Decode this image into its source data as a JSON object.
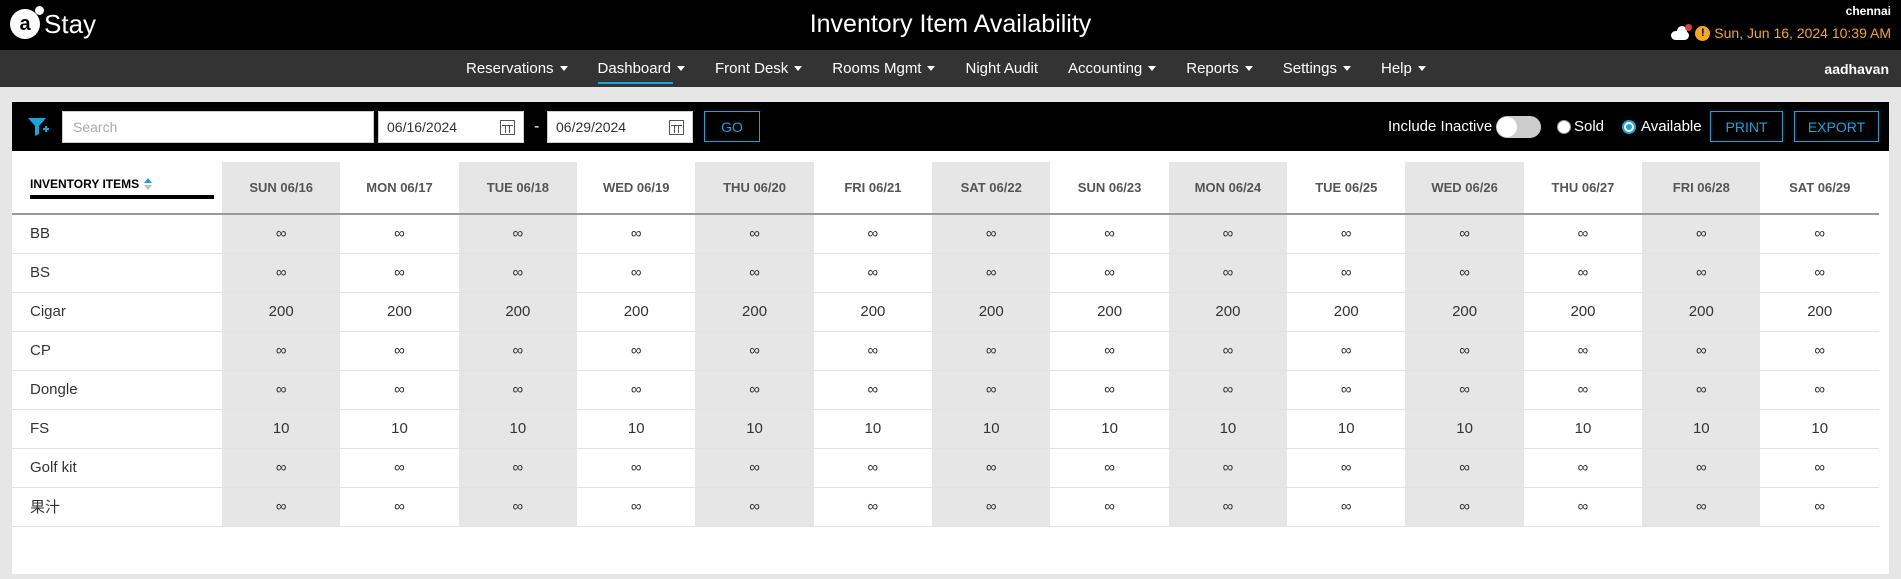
{
  "app": {
    "logo_letter": "a",
    "logo_text": "Stay",
    "title": "Inventory Item Availability",
    "location": "chennai",
    "datetime": "Sun, Jun 16, 2024 10:39 AM",
    "alert_glyph": "!"
  },
  "nav": {
    "items": [
      {
        "label": "Reservations",
        "dropdown": true
      },
      {
        "label": "Dashboard",
        "dropdown": true,
        "active": true
      },
      {
        "label": "Front Desk",
        "dropdown": true
      },
      {
        "label": "Rooms Mgmt",
        "dropdown": true
      },
      {
        "label": "Night Audit",
        "dropdown": false
      },
      {
        "label": "Accounting",
        "dropdown": true
      },
      {
        "label": "Reports",
        "dropdown": true
      },
      {
        "label": "Settings",
        "dropdown": true
      },
      {
        "label": "Help",
        "dropdown": true
      }
    ],
    "user": "aadhavan"
  },
  "toolbar": {
    "search_placeholder": "Search",
    "search_value": "",
    "start_date": "06/16/2024",
    "end_date": "06/29/2024",
    "date_separator": "-",
    "go_label": "GO",
    "include_inactive_label": "Include Inactive",
    "include_inactive_on": false,
    "sold_label": "Sold",
    "available_label": "Available",
    "selected_mode": "Available",
    "print_label": "PRINT",
    "export_label": "EXPORT",
    "accent_color": "#1aa3d9"
  },
  "table": {
    "item_header": "INVENTORY ITEMS",
    "columns": [
      "SUN 06/16",
      "MON 06/17",
      "TUE 06/18",
      "WED 06/19",
      "THU 06/20",
      "FRI 06/21",
      "SAT 06/22",
      "SUN 06/23",
      "MON 06/24",
      "TUE 06/25",
      "WED 06/26",
      "THU 06/27",
      "FRI 06/28",
      "SAT 06/29"
    ],
    "rows": [
      {
        "item": "BB",
        "values": [
          "∞",
          "∞",
          "∞",
          "∞",
          "∞",
          "∞",
          "∞",
          "∞",
          "∞",
          "∞",
          "∞",
          "∞",
          "∞",
          "∞"
        ]
      },
      {
        "item": "BS",
        "values": [
          "∞",
          "∞",
          "∞",
          "∞",
          "∞",
          "∞",
          "∞",
          "∞",
          "∞",
          "∞",
          "∞",
          "∞",
          "∞",
          "∞"
        ]
      },
      {
        "item": "Cigar",
        "values": [
          "200",
          "200",
          "200",
          "200",
          "200",
          "200",
          "200",
          "200",
          "200",
          "200",
          "200",
          "200",
          "200",
          "200"
        ]
      },
      {
        "item": "CP",
        "values": [
          "∞",
          "∞",
          "∞",
          "∞",
          "∞",
          "∞",
          "∞",
          "∞",
          "∞",
          "∞",
          "∞",
          "∞",
          "∞",
          "∞"
        ]
      },
      {
        "item": "Dongle",
        "values": [
          "∞",
          "∞",
          "∞",
          "∞",
          "∞",
          "∞",
          "∞",
          "∞",
          "∞",
          "∞",
          "∞",
          "∞",
          "∞",
          "∞"
        ]
      },
      {
        "item": "FS",
        "values": [
          "10",
          "10",
          "10",
          "10",
          "10",
          "10",
          "10",
          "10",
          "10",
          "10",
          "10",
          "10",
          "10",
          "10"
        ]
      },
      {
        "item": "Golf kit",
        "values": [
          "∞",
          "∞",
          "∞",
          "∞",
          "∞",
          "∞",
          "∞",
          "∞",
          "∞",
          "∞",
          "∞",
          "∞",
          "∞",
          "∞"
        ]
      },
      {
        "item": "果汁",
        "values": [
          "∞",
          "∞",
          "∞",
          "∞",
          "∞",
          "∞",
          "∞",
          "∞",
          "∞",
          "∞",
          "∞",
          "∞",
          "∞",
          "∞"
        ]
      }
    ]
  }
}
